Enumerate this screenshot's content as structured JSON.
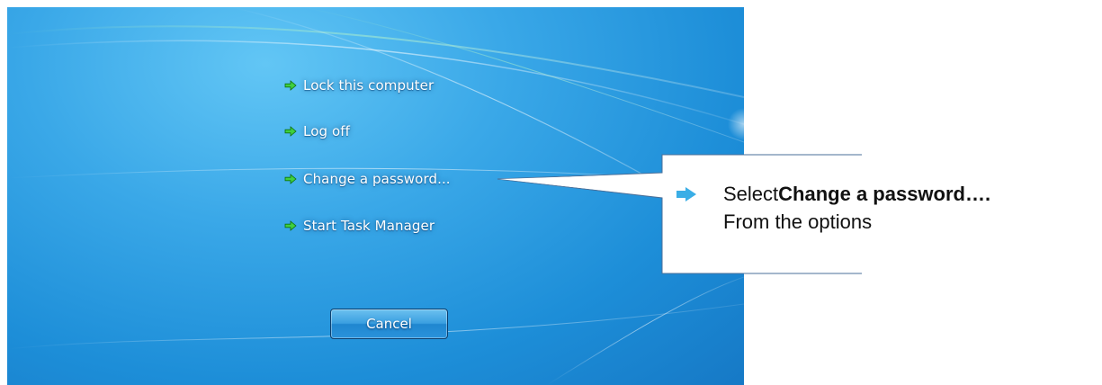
{
  "options": [
    {
      "label": "Lock this computer"
    },
    {
      "label": "Log off"
    },
    {
      "label": "Change a password..."
    },
    {
      "label": "Start Task Manager"
    }
  ],
  "cancel_button": {
    "label": "Cancel"
  },
  "callout": {
    "prefix": "Select ",
    "emphasis": "Change a password….",
    "line2": "From the options"
  },
  "colors": {
    "background_blue": "#2196e0",
    "arrow_green": "#33cc33",
    "callout_bullet": "#3aaee6"
  },
  "icons": {
    "option_arrow": "green-arrow-icon",
    "callout_bullet": "blue-arrow-bullet-icon"
  }
}
